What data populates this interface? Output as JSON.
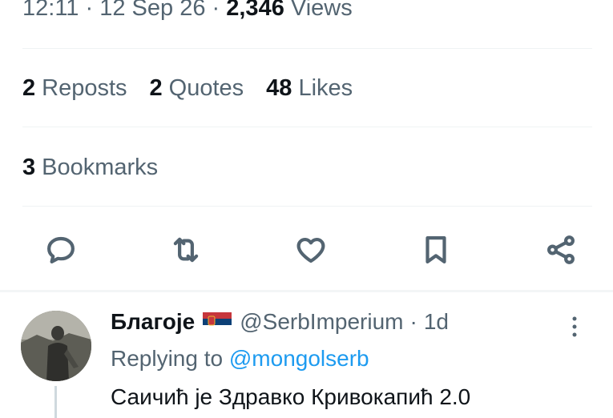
{
  "tweet": {
    "time": "12:11",
    "sep1": "·",
    "date": "12 Sep 26",
    "sep2": "·",
    "views_count": "2,346",
    "views_label": "Views",
    "stats": {
      "reposts_count": "2",
      "reposts_label": "Reposts",
      "quotes_count": "2",
      "quotes_label": "Quotes",
      "likes_count": "48",
      "likes_label": "Likes",
      "bookmarks_count": "3",
      "bookmarks_label": "Bookmarks"
    },
    "actions": [
      "reply-icon",
      "repost-icon",
      "like-icon",
      "bookmark-icon",
      "share-icon"
    ]
  },
  "reply": {
    "name": "Благоје",
    "flag": "serbian-flag",
    "handle": "@SerbImperium",
    "dot": "·",
    "time": "1d",
    "replying_prefix": "Replying to",
    "replying_to": "@mongolserb",
    "text": "Саичић је Здравко Кривокапић 2.0"
  },
  "colors": {
    "text": "#0f1419",
    "secondary": "#536471",
    "link": "#1d9bf0",
    "divider": "#eff3f4"
  }
}
